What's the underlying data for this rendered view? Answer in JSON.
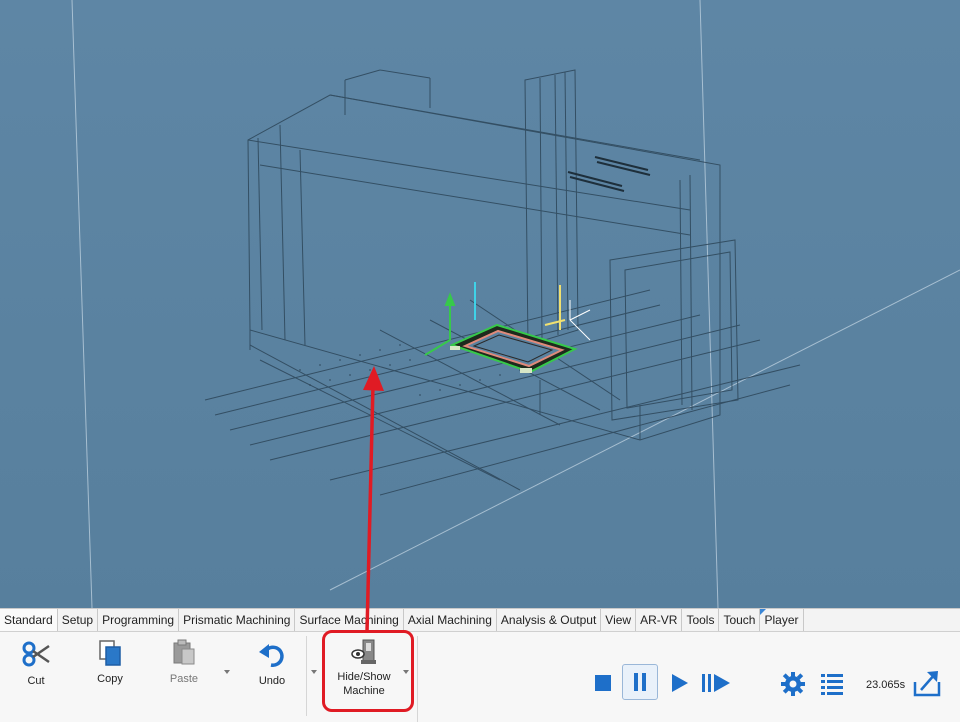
{
  "tabs": [
    {
      "label": "Standard"
    },
    {
      "label": "Setup"
    },
    {
      "label": "Programming"
    },
    {
      "label": "Prismatic Machining"
    },
    {
      "label": "Surface Machining"
    },
    {
      "label": "Axial Machining"
    },
    {
      "label": "Analysis & Output"
    },
    {
      "label": "View"
    },
    {
      "label": "AR-VR"
    },
    {
      "label": "Tools"
    },
    {
      "label": "Touch"
    },
    {
      "label": "Player"
    }
  ],
  "toolbar": {
    "cut_label": "Cut",
    "copy_label": "Copy",
    "paste_label": "Paste",
    "undo_label": "Undo",
    "hide_show_line1": "Hide/Show",
    "hide_show_line2": "Machine"
  },
  "player": {
    "elapsed_time": "23.065s"
  },
  "colors": {
    "viewport_bg": "#5a82a0",
    "highlight": "#e01b24",
    "accent_blue": "#1e6fc9"
  }
}
